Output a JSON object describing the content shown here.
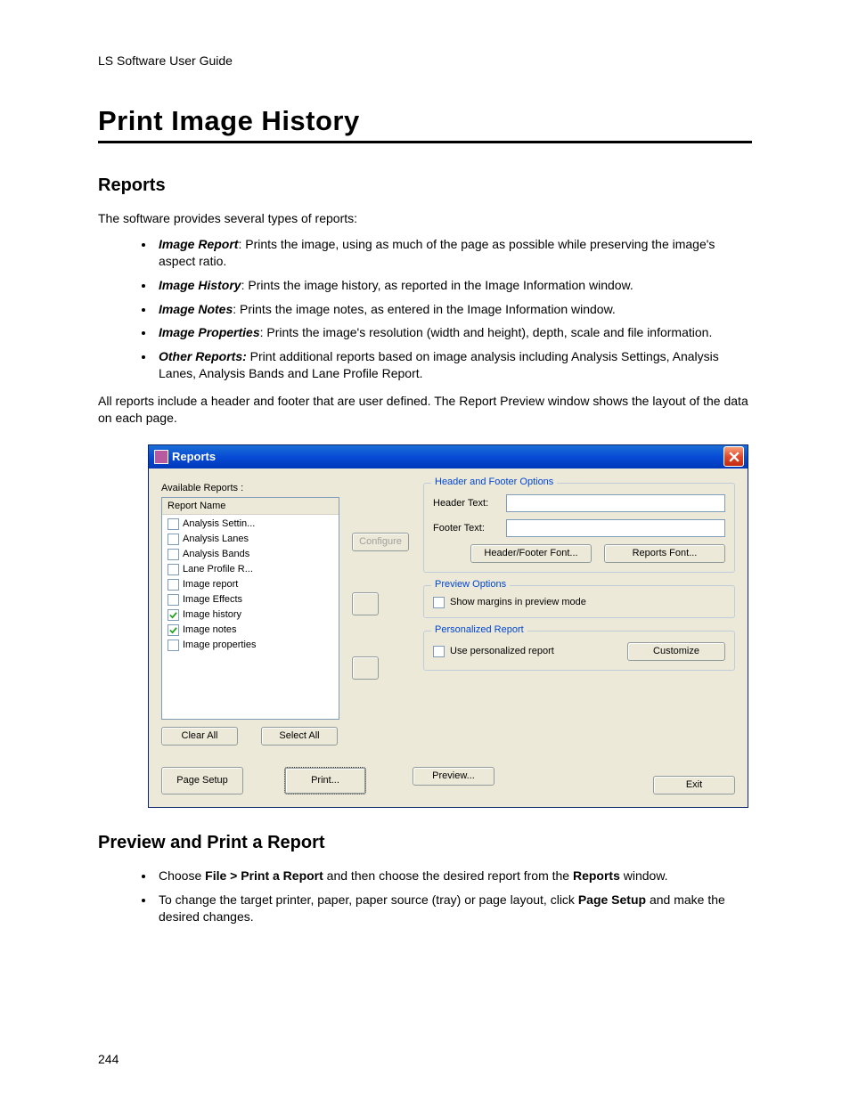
{
  "doc_header": "LS Software User Guide",
  "title": "Print Image History",
  "section_reports": "Reports",
  "p_intro": "The software provides several types of reports:",
  "bullets": [
    {
      "lead": "Image Report",
      "rest": ": Prints the image, using as much of the page as possible while preserving the image's aspect ratio."
    },
    {
      "lead": "Image History",
      "rest": ": Prints the image history, as reported in the Image Information window."
    },
    {
      "lead": "Image Notes",
      "rest": ": Prints the image notes, as entered in the Image Information window."
    },
    {
      "lead": "Image Properties",
      "rest": ": Prints the image's resolution (width and height), depth, scale and file information."
    },
    {
      "lead": "Other Reports:",
      "rest": " Print additional reports based on image analysis including Analysis Settings, Analysis Lanes, Analysis Bands and Lane Profile Report."
    }
  ],
  "p_footer": "All reports include a header and footer that are user defined. The Report Preview window shows the layout of the data on each page.",
  "dialog": {
    "title": "Reports",
    "available_label": "Available Reports :",
    "col_header": "Report Name",
    "items": [
      {
        "label": "Analysis Settin...",
        "checked": false
      },
      {
        "label": "Analysis Lanes",
        "checked": false
      },
      {
        "label": "Analysis Bands",
        "checked": false
      },
      {
        "label": "Lane Profile R...",
        "checked": false
      },
      {
        "label": "Image report",
        "checked": false
      },
      {
        "label": "Image Effects",
        "checked": false
      },
      {
        "label": "Image history",
        "checked": true
      },
      {
        "label": "Image notes",
        "checked": true
      },
      {
        "label": "Image properties",
        "checked": false
      }
    ],
    "clear_all": "Clear All",
    "select_all": "Select All",
    "configure": "Configure",
    "group_hf": "Header and Footer Options",
    "header_text_label": "Header Text:",
    "footer_text_label": "Footer Text:",
    "hf_font_btn": "Header/Footer Font...",
    "reports_font_btn": "Reports Font...",
    "group_preview": "Preview Options",
    "show_margins": "Show margins in preview mode",
    "group_pers": "Personalized Report",
    "use_personalized": "Use personalized report",
    "customize": "Customize",
    "page_setup": "Page Setup",
    "print": "Print...",
    "preview": "Preview...",
    "exit": "Exit"
  },
  "section_preview": "Preview and Print a Report",
  "preview_bullets": {
    "b1_pre": "Choose ",
    "b1_bold1": "File > Print a Report",
    "b1_mid": " and then choose the desired report from the ",
    "b1_bold2": "Reports",
    "b1_post": " window.",
    "b2_pre": "To change the target printer, paper, paper source (tray) or page layout, click ",
    "b2_bold": "Page Setup",
    "b2_post": " and make the desired changes."
  },
  "page_number": "244"
}
